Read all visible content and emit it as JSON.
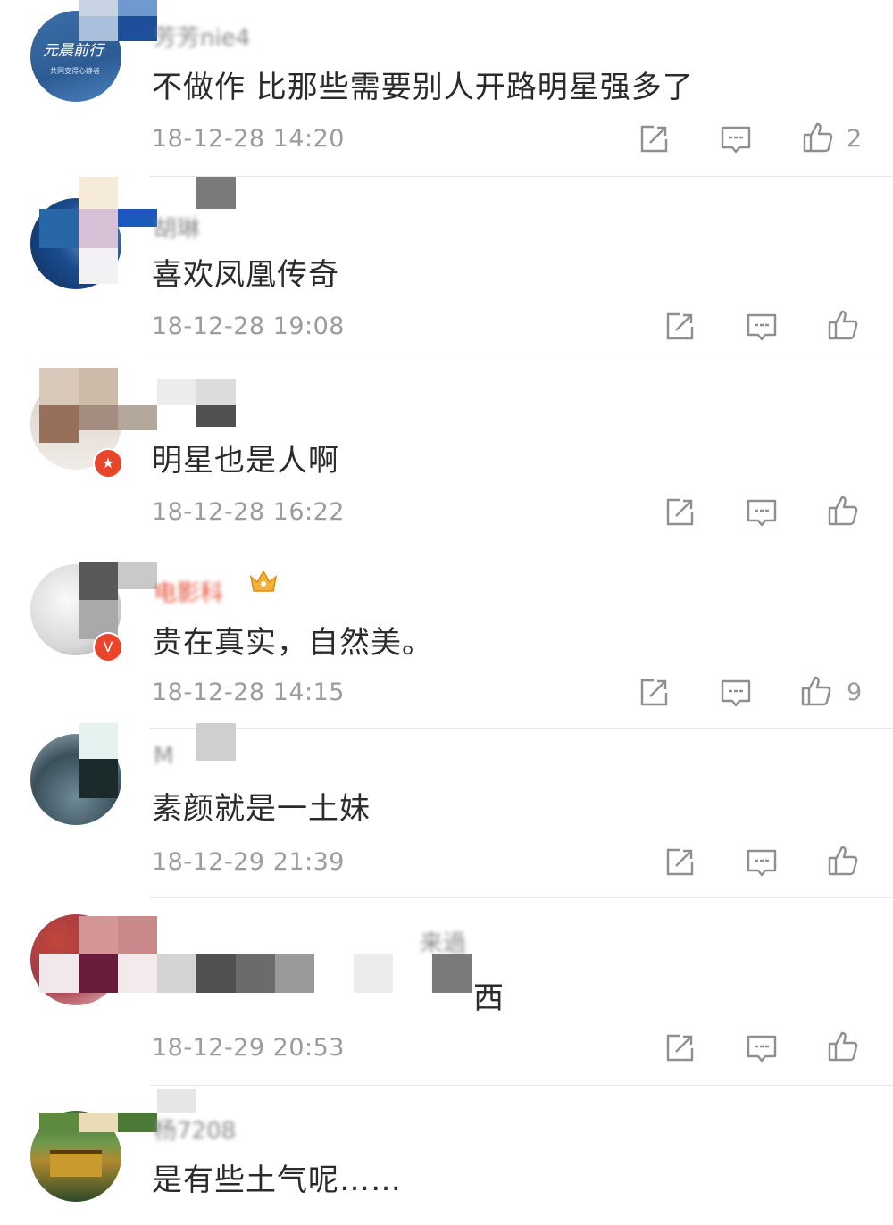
{
  "comments": [
    {
      "username": "芳芳nie4",
      "text": "不做作 比那些需要别人开路明星强多了",
      "timestamp": "18-12-28 14:20",
      "like_count": "2",
      "avatar_text_1": "元晨前行",
      "avatar_text_2": "共同变得心静者"
    },
    {
      "username": "胡琳",
      "text": "喜欢凤凰传奇",
      "timestamp": "18-12-28 19:08",
      "like_count": ""
    },
    {
      "username": "",
      "text": "明星也是人啊",
      "timestamp": "18-12-28 16:22",
      "like_count": ""
    },
    {
      "username": "电影科",
      "text": "贵在真实，自然美。",
      "timestamp": "18-12-28 14:15",
      "like_count": "9"
    },
    {
      "username": "M",
      "text": "素颜就是一土妹",
      "timestamp": "18-12-29 21:39",
      "like_count": ""
    },
    {
      "username": "来過",
      "text": "西",
      "timestamp": "18-12-29 20:53",
      "like_count": ""
    },
    {
      "username": "杨7208",
      "text": "是有些土气呢……",
      "timestamp": "",
      "like_count": ""
    }
  ],
  "icons": {
    "forward": "share-icon",
    "comment": "comment-icon",
    "like": "thumbs-up-icon"
  },
  "colors": {
    "text": "#2b2b2b",
    "meta": "#9c9c9c",
    "icon": "#8f8f8f",
    "divider": "#e6e6e6",
    "badge": "#e8452b"
  }
}
